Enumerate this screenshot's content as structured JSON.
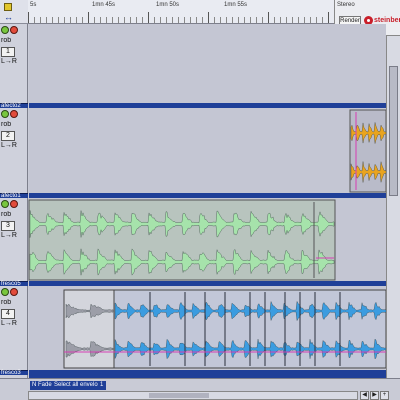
{
  "ruler": {
    "labels": [
      "5s",
      "1mn 45s",
      "1mn 50s",
      "1mn 55s"
    ]
  },
  "logo": {
    "title": "Stereo",
    "render_label": "Render",
    "brand": "steinberg"
  },
  "tracks": [
    {
      "mode": "rob",
      "number": "1",
      "lr": "L→R",
      "name": ""
    },
    {
      "mode": "rob",
      "number": "2",
      "lr": "L→R",
      "name": "afecto2"
    },
    {
      "mode": "rob",
      "number": "3",
      "lr": "L→R",
      "name": "afecto1"
    },
    {
      "mode": "rob",
      "number": "4",
      "lr": "L→R",
      "name": "fresco5"
    }
  ],
  "last_track_name": "fresco3",
  "status": {
    "mode": "N Fade",
    "hint": "Select all envelope",
    "count": "1"
  },
  "colors": {
    "panel": "#c4c6d3",
    "separator": "#1f3f98",
    "wave_green": "#a6e3ab",
    "wave_orange": "#e9a41f",
    "wave_blue": "#3b9ce0",
    "wave_grey": "#8a8c99",
    "envelope": "#d63eb4",
    "brand_red": "#c91f2a"
  },
  "icons": [
    "cursor-icon",
    "power-icon",
    "record-icon",
    "steinberg-logo-icon"
  ]
}
